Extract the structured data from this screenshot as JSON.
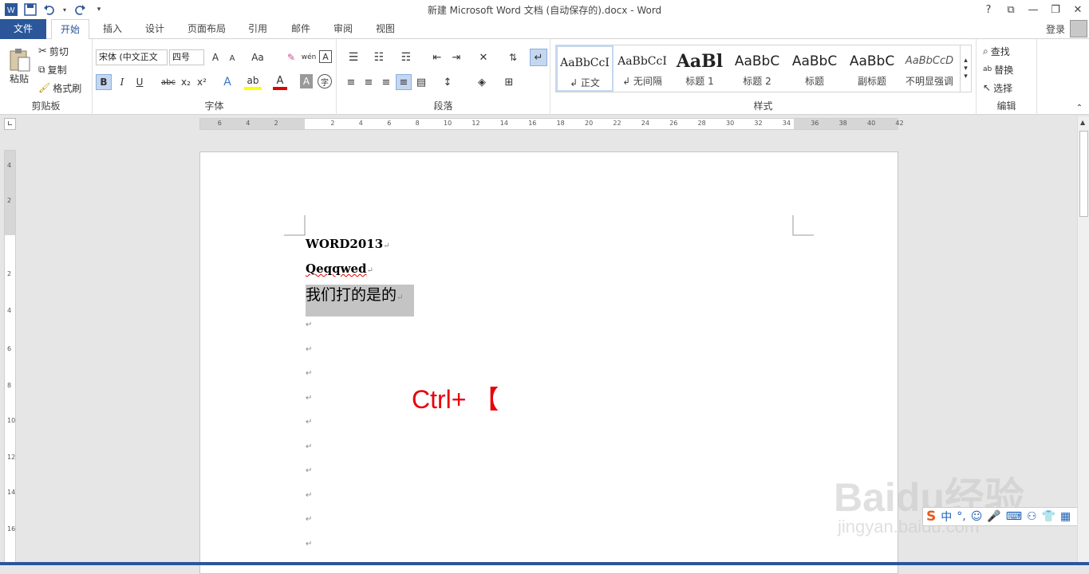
{
  "window": {
    "title": "新建 Microsoft Word 文档 (自动保存的).docx - Word",
    "controls": [
      "?",
      "⧉",
      "—",
      "❐",
      "✕"
    ]
  },
  "tabs": [
    "文件",
    "开始",
    "插入",
    "设计",
    "页面布局",
    "引用",
    "邮件",
    "审阅",
    "视图"
  ],
  "account": {
    "login_label": "登录"
  },
  "clipboard": {
    "paste": "粘贴",
    "cut": "剪切",
    "copy": "复制",
    "format_painter": "格式刷",
    "group_label": "剪贴板"
  },
  "font": {
    "name": "宋体 (中文正文",
    "size": "四号",
    "group_label": "字体",
    "buttons": [
      "A",
      "A",
      "Aa",
      "B",
      "I",
      "U",
      "abc",
      "x₂",
      "x²"
    ]
  },
  "paragraph": {
    "group_label": "段落"
  },
  "styles": {
    "group_label": "样式",
    "items": [
      {
        "preview": "AaBbCcI",
        "name": "↲ 正文"
      },
      {
        "preview": "AaBbCcI",
        "name": "↲ 无间隔"
      },
      {
        "preview": "AaBl",
        "name": "标题 1"
      },
      {
        "preview": "AaBbC",
        "name": "标题 2"
      },
      {
        "preview": "AaBbC",
        "name": "标题"
      },
      {
        "preview": "AaBbC",
        "name": "副标题"
      },
      {
        "preview": "AaBbCcD",
        "name": "不明显强调"
      }
    ]
  },
  "editing": {
    "find": "查找",
    "replace": "替换",
    "select": "选择",
    "group_label": "编辑"
  },
  "ruler": {
    "h_left": [
      "6",
      "4",
      "2"
    ],
    "h_right": [
      "2",
      "4",
      "6",
      "8",
      "10",
      "12",
      "14",
      "16",
      "18",
      "20",
      "22",
      "24",
      "26",
      "28",
      "30",
      "32",
      "34",
      "36",
      "38",
      "40",
      "42"
    ],
    "v": [
      "4",
      "2",
      "2",
      "4",
      "6",
      "8",
      "10",
      "12",
      "14",
      "16"
    ]
  },
  "document": {
    "line1": "WORD2013",
    "line2": "Qeqqwed",
    "line3": "我们打的是的",
    "para_mark": "↵"
  },
  "overlay": {
    "shortcut": "Ctrl+ 【",
    "watermark_main": "Baidu经验",
    "watermark_url": "jingyan.baidu.com",
    "ime": "中"
  }
}
